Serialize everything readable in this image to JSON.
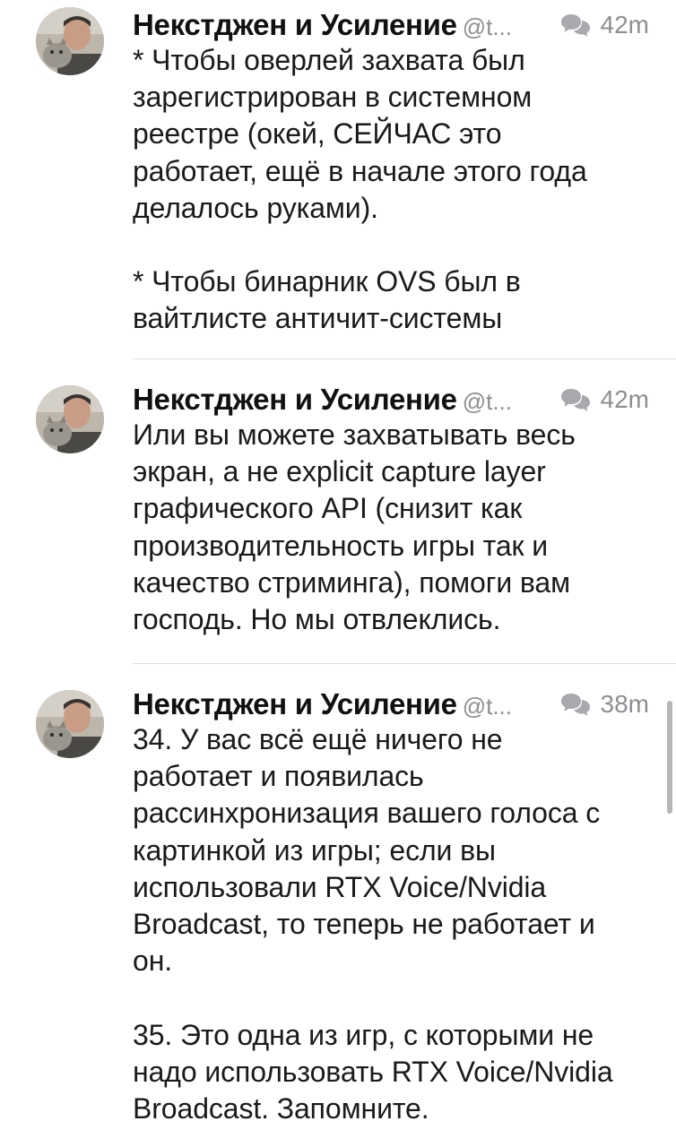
{
  "tweets": [
    {
      "author": "Некстджен и Усиление",
      "handle": "@t...",
      "time": "42m",
      "body": "* Чтобы оверлей захвата был\nзарегистрирован в системном\nреестре (окей, СЕЙЧАС это\nработает, ещё в начале этого года\nделалось руками).\n\n* Чтобы бинарник OVS был в\nвайтлисте античит-системы"
    },
    {
      "author": "Некстджен и Усиление",
      "handle": "@t...",
      "time": "42m",
      "body": "Или вы можете захватывать весь\nэкран, а не explicit capture layer\nграфического API (снизит как\nпроизводительность игры так и\nкачество стриминга), помоги вам\nгосподь. Но мы отвлеклись."
    },
    {
      "author": "Некстджен и Усиление",
      "handle": "@t...",
      "time": "38m",
      "body": "34. У вас всё ещё ничего не\nработает и появилась\nрассинхронизация вашего голоса с\nкартинкой из игры; если вы\nиспользовали RTX Voice/Nvidia\nBroadcast, то теперь не работает и\nон.\n\n35. Это одна из игр, с которыми не\nнадо использовать RTX Voice/Nvidia\nBroadcast. Запомните."
    }
  ],
  "icons": {
    "conversation": "conversation-bubbles-icon"
  },
  "colors": {
    "text": "#1a1a1a",
    "secondary": "#8e8e93",
    "divider": "#dcdcdc",
    "scrollbar": "#b7b7b7"
  }
}
